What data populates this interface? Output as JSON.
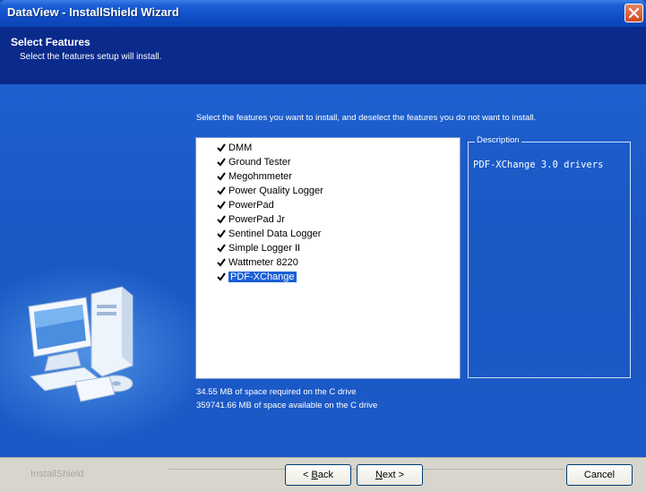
{
  "window": {
    "title": "DataView - InstallShield Wizard"
  },
  "header": {
    "title": "Select Features",
    "subtitle": "Select the features setup will install."
  },
  "instruction": "Select the features you want to install, and deselect the features you do not want to install.",
  "features": [
    {
      "label": "DMM",
      "checked": true
    },
    {
      "label": "Ground Tester",
      "checked": true
    },
    {
      "label": "Megohmmeter",
      "checked": true
    },
    {
      "label": "Power Quality Logger",
      "checked": true
    },
    {
      "label": "PowerPad",
      "checked": true
    },
    {
      "label": "PowerPad Jr",
      "checked": true
    },
    {
      "label": "Sentinel Data Logger",
      "checked": true
    },
    {
      "label": "Simple Logger II",
      "checked": true
    },
    {
      "label": "Wattmeter 8220",
      "checked": true
    },
    {
      "label": "PDF-XChange",
      "checked": true,
      "selected": true
    }
  ],
  "description": {
    "label": "Description",
    "text": "PDF-XChange 3.0 drivers"
  },
  "space": {
    "required": "34.55 MB of space required on the C drive",
    "available": "359741.66 MB of space available on the C drive"
  },
  "footer": {
    "brand": "InstallShield",
    "back_prefix": "< ",
    "back_mnemonic": "B",
    "back_rest": "ack",
    "next_mnemonic": "N",
    "next_rest": "ext >",
    "cancel": "Cancel"
  },
  "colors": {
    "header_bg": "#0a2a8c",
    "body_bg": "#1d60cf",
    "selection": "#1a5fd6"
  }
}
